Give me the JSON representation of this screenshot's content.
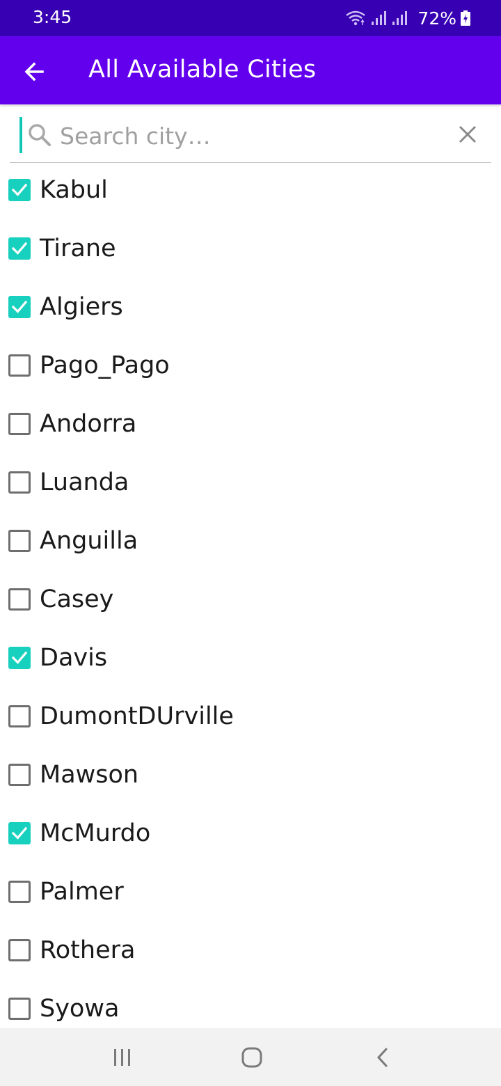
{
  "status_bar": {
    "time": "3:45",
    "battery": "72%",
    "icons": [
      "wifi-icon",
      "signal-icon",
      "signal-icon",
      "battery-charging-icon"
    ]
  },
  "app_bar": {
    "title": "All Available Cities",
    "back_icon": "arrow-back-icon"
  },
  "search": {
    "placeholder": "Search city…",
    "value": "",
    "search_icon": "search-icon",
    "clear_icon": "close-icon"
  },
  "colors": {
    "status_bar": "#3700b3",
    "app_bar": "#6200ee",
    "accent": "#18d0be"
  },
  "cities": [
    {
      "label": "Kabul",
      "checked": true
    },
    {
      "label": "Tirane",
      "checked": true
    },
    {
      "label": "Algiers",
      "checked": true
    },
    {
      "label": "Pago_Pago",
      "checked": false
    },
    {
      "label": "Andorra",
      "checked": false
    },
    {
      "label": "Luanda",
      "checked": false
    },
    {
      "label": "Anguilla",
      "checked": false
    },
    {
      "label": "Casey",
      "checked": false
    },
    {
      "label": "Davis",
      "checked": true
    },
    {
      "label": "DumontDUrville",
      "checked": false
    },
    {
      "label": "Mawson",
      "checked": false
    },
    {
      "label": "McMurdo",
      "checked": true
    },
    {
      "label": "Palmer",
      "checked": false
    },
    {
      "label": "Rothera",
      "checked": false
    },
    {
      "label": "Syowa",
      "checked": false
    }
  ],
  "nav_bar": {
    "icons": [
      "recent-apps-icon",
      "home-icon",
      "back-icon"
    ]
  }
}
